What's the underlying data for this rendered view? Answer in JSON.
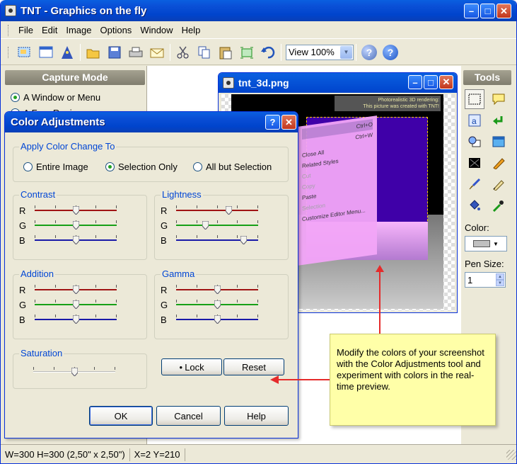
{
  "app": {
    "title": "TNT - Graphics on the fly",
    "menu": [
      "File",
      "Edit",
      "Image",
      "Options",
      "Window",
      "Help"
    ],
    "zoom": "View 100%"
  },
  "capture_mode": {
    "header": "Capture Mode",
    "options": [
      "A Window or Menu",
      "A Free Region"
    ],
    "selected": "A Window or Menu"
  },
  "image_window": {
    "title": "tnt_3d.png",
    "note_lines": [
      "Photorealistic 3D rendering:",
      "This picture was created with TNT!"
    ],
    "menu_items": [
      "Ctrl+O",
      "Ctrl+W",
      "Close All",
      "Related Styles",
      "Cut",
      "Copy",
      "Paste",
      "Selection",
      "Customize Editor Menu..."
    ]
  },
  "tools": {
    "header": "Tools",
    "color_label": "Color:",
    "pen_size_label": "Pen Size:",
    "pen_size_value": "1"
  },
  "status": {
    "size": "W=300  H=300  (2,50\" x 2,50\")",
    "coords": "X=2  Y=210"
  },
  "dialog": {
    "title": "Color Adjustments",
    "help_glyph": "?",
    "apply_group": "Apply Color Change To",
    "apply_options": [
      "Entire Image",
      "Selection Only",
      "All but Selection"
    ],
    "apply_selected": "Selection Only",
    "contrast": {
      "label": "Contrast",
      "R": 0.5,
      "G": 0.5,
      "B": 0.5
    },
    "lightness": {
      "label": "Lightness",
      "R": 0.65,
      "G": 0.35,
      "B": 0.85
    },
    "addition": {
      "label": "Addition",
      "R": 0.5,
      "G": 0.5,
      "B": 0.5
    },
    "gamma": {
      "label": "Gamma",
      "R": 0.5,
      "G": 0.5,
      "B": 0.5
    },
    "saturation": {
      "label": "Saturation",
      "value": 0.5
    },
    "channel_labels": [
      "R",
      "G",
      "B"
    ],
    "lock_label": "Lock",
    "reset_label": "Reset",
    "ok_label": "OK",
    "cancel_label": "Cancel",
    "help_label": "Help"
  },
  "callout": {
    "text": "Modify the colors of your screenshot with the Color Adjustments tool and experiment with colors in the real-time preview."
  },
  "colors": {
    "red_channel": "#a01414",
    "green_channel": "#17a017",
    "blue_channel": "#1a1aa8",
    "accent_title": "#0044cc",
    "group_label": "#0046d5",
    "arrow": "#e52b2b"
  }
}
